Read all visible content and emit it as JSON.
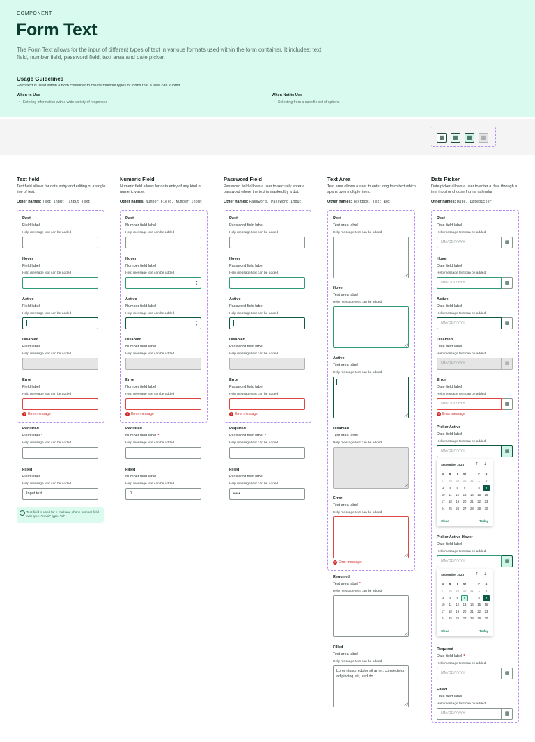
{
  "header": {
    "eyebrow": "COMPONENT",
    "title": "Form Text",
    "description": "The Form Text allows for the input of different types of text in various formats used within the form container. It includes: text field, number field, password field, text area and date picker."
  },
  "usage": {
    "title": "Usage Guidelines",
    "description": "Form text is used within a from container to create multiple types of forms that a user can submit.",
    "when_to_use": "When to Use",
    "when_to_use_item": "Entering information with a wide variety of responses",
    "when_not": "When Not to Use",
    "when_not_item": "Selecting from a specific set of options"
  },
  "icons": {
    "calendar": "calendar-icon",
    "error": "error-icon",
    "info": "info-icon"
  },
  "colors": {
    "accent": "#0f5a46",
    "hero_bg": "#d9fbef",
    "error": "#d22b2b",
    "hover": "#2f9a74"
  },
  "states": {
    "rest": "Rest",
    "hover": "Hover",
    "active": "Active",
    "disabled": "Disabled",
    "error": "Error",
    "required": "Required",
    "filled": "Filled",
    "picker_active": "Picker Active",
    "picker_active_hover": "Picker Active Hover"
  },
  "help": "Help message text can be added",
  "error_message": "Error message",
  "other_names_label": "Other names:",
  "text_field": {
    "title": "Text field",
    "desc": "Text field allows for data entry and editing of a single line of text.",
    "other": "Text Input, Input Text",
    "label": "Field label",
    "filled_value": "Input text",
    "note": "Text field is used for e-mail and phone number field with type=\"email\" type=\"tel\""
  },
  "numeric_field": {
    "title": "Numeric Field",
    "desc": "Numeric field allows for data entry of any kind of numeric value.",
    "other": "Number Field, Number Input",
    "label": "Number field label",
    "filled_value": "0"
  },
  "password_field": {
    "title": "Password Field",
    "desc": "Password field allows a user to securely enter a password where the text is masked by a dot.",
    "other": "Password, Password Input",
    "label": "Password field label",
    "filled_value": "•••••"
  },
  "text_area": {
    "title": "Text Area",
    "desc": "Text area allows a user to enter long form text which spans over multiple lines.",
    "other": "Textbox, Text Box",
    "label": "Text area label",
    "filled_value": "Lorem ipsum dolor sit amet, consectetur adipiscing elit, sed do"
  },
  "date_picker": {
    "title": "Date Picker",
    "desc": "Date picker allows a user to enter a date through a text input or choose from a calendar.",
    "other": "Date, Datepicker",
    "label": "Date field label",
    "placeholder": "MM/DD/YYYY",
    "calendar": {
      "month": "September 2023",
      "nav": "↑ ↓",
      "dow": [
        "S",
        "M",
        "T",
        "W",
        "T",
        "F",
        "S"
      ],
      "days": [
        "27",
        "28",
        "29",
        "30",
        "31",
        "1",
        "2",
        "3",
        "4",
        "5",
        "6",
        "7",
        "8",
        "9",
        "10",
        "11",
        "12",
        "13",
        "14",
        "15",
        "16",
        "17",
        "18",
        "19",
        "20",
        "21",
        "22",
        "23",
        "24",
        "25",
        "26",
        "27",
        "28",
        "29",
        "30"
      ],
      "selected": "9",
      "hovered": "6",
      "clear": "Clear",
      "today": "Today"
    }
  }
}
